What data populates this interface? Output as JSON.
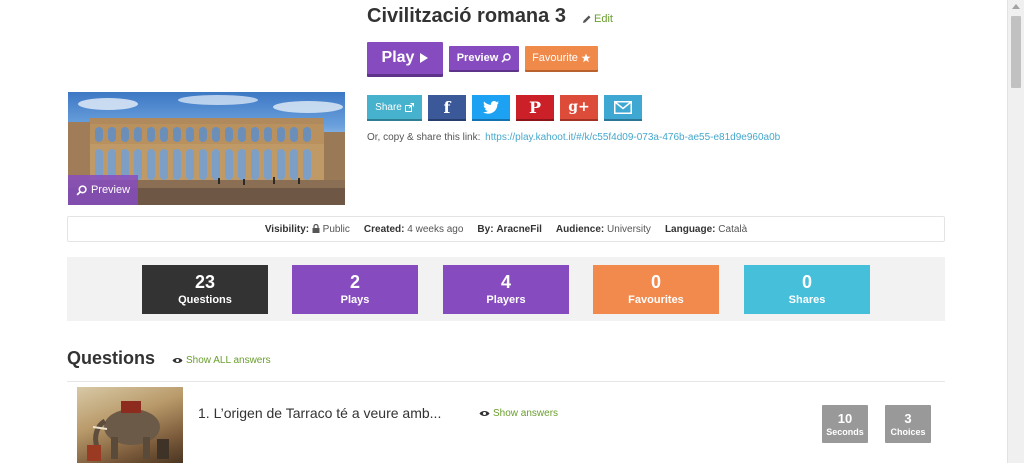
{
  "kahoot": {
    "title": "Civilització romana 3",
    "edit_label": "Edit"
  },
  "actions": {
    "play_label": "Play",
    "preview_label": "Preview",
    "favourite_label": "Favourite"
  },
  "share": {
    "share_label": "Share",
    "facebook_glyph": "f",
    "pinterest_glyph": "P",
    "googleplus_glyph": "g+",
    "copy_text": "Or, copy & share this link:",
    "link": "https://play.kahoot.it/#/k/c55f4d09-073a-476b-ae55-e81d9e960a0b"
  },
  "cover": {
    "preview_label": "Preview"
  },
  "meta": {
    "visibility_label": "Visibility:",
    "visibility_value": "Public",
    "created_label": "Created:",
    "created_value": "4 weeks ago",
    "by_label": "By:",
    "by_value": "AracneFil",
    "audience_label": "Audience:",
    "audience_value": "University",
    "language_label": "Language:",
    "language_value": "Català"
  },
  "stats": [
    {
      "value": "23",
      "label": "Questions",
      "color": "#333333"
    },
    {
      "value": "2",
      "label": "Plays",
      "color": "#864cbf"
    },
    {
      "value": "4",
      "label": "Players",
      "color": "#864cbf"
    },
    {
      "value": "0",
      "label": "Favourites",
      "color": "#f2894d"
    },
    {
      "value": "0",
      "label": "Shares",
      "color": "#46bfdb"
    }
  ],
  "questions": {
    "heading": "Questions",
    "show_all_label": "Show ALL answers",
    "items": [
      {
        "text": "1. L’origen de Tarraco té a veure amb...",
        "show_answers_label": "Show answers",
        "time_value": "10",
        "time_label": "Seconds",
        "choices_value": "3",
        "choices_label": "Choices"
      }
    ]
  },
  "colors": {
    "purple": "#864cbf",
    "orange": "#f08a4b",
    "green_link": "#6a9e2e",
    "blue_link": "#46a8cc"
  }
}
